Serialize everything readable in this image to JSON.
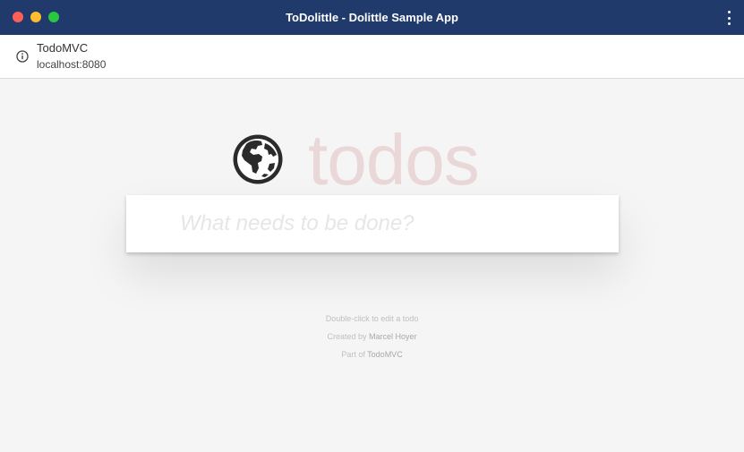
{
  "window": {
    "title": "ToDolittle - Dolittle Sample App"
  },
  "site": {
    "title": "TodoMVC",
    "url": "localhost:8080"
  },
  "app": {
    "heading": "todos",
    "new_todo_placeholder": "What needs to be done?"
  },
  "info": {
    "hint": "Double-click to edit a todo",
    "created_prefix": "Created by",
    "author": "Marcel Hoyer",
    "part_prefix": "Part of",
    "part_link": "TodoMVC"
  },
  "colors": {
    "titlebar": "#1f3a6b",
    "heading": "#e6c9c9",
    "background": "#f5f5f5"
  },
  "icons": {
    "info": "info-circle-icon",
    "logo": "globe-icon",
    "menu": "kebab-menu-icon"
  }
}
